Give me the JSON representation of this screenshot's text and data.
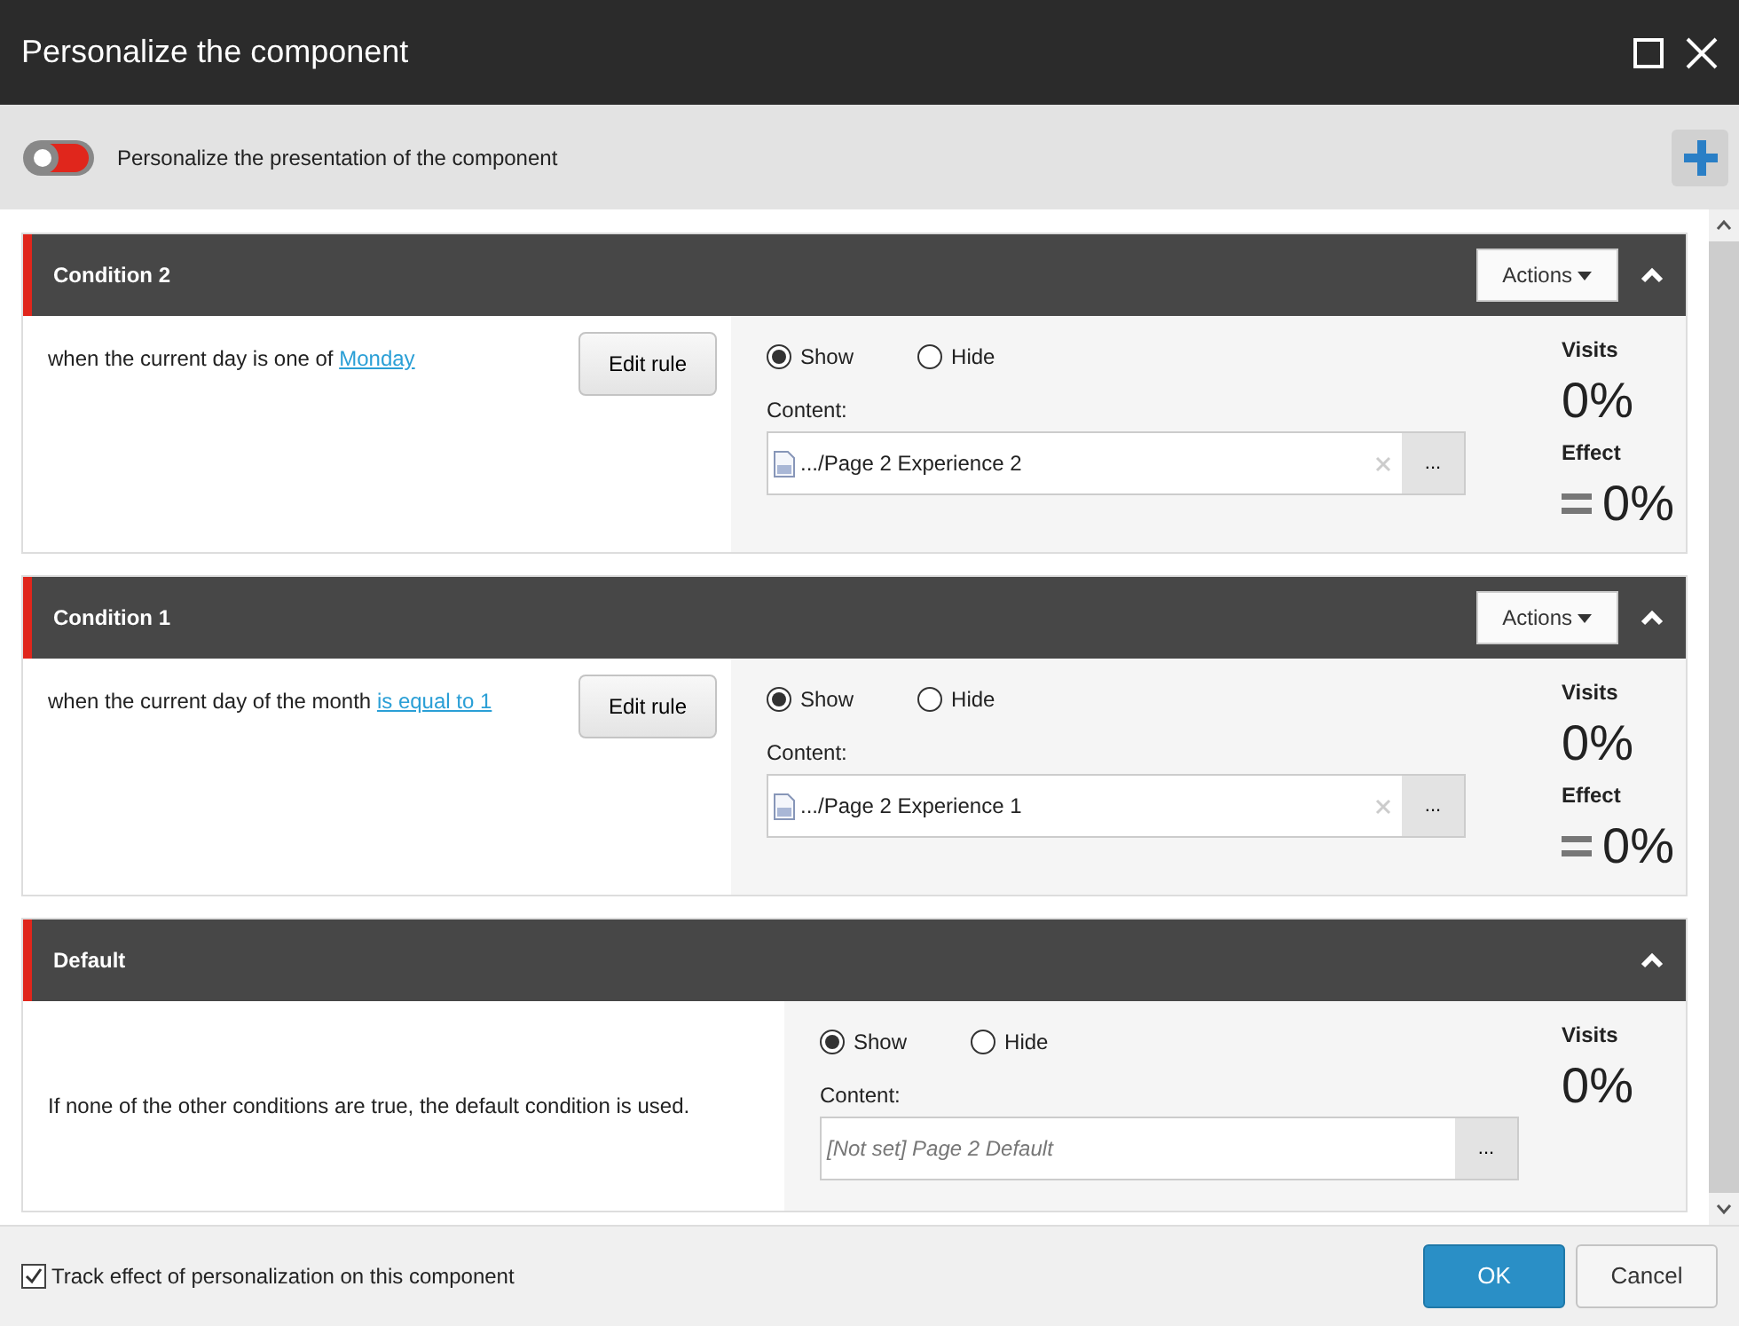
{
  "window": {
    "title": "Personalize the component"
  },
  "toolbar": {
    "toggle_on": false,
    "label": "Personalize the presentation of the component"
  },
  "panels": [
    {
      "kind": "condition",
      "title": "Condition 2",
      "expanded": true,
      "actions": "Actions",
      "rule": {
        "text": "when the current day is one of ",
        "link": "Monday"
      },
      "edit_button": "Edit rule",
      "options": [
        {
          "label": "Show",
          "selected": true
        },
        {
          "label": "Hide",
          "selected": false
        }
      ],
      "content_label": "Content:",
      "content": {
        "value": ".../Page 2 Experience 2",
        "is_set": true,
        "browse": "..."
      },
      "visits_label": "Visits",
      "visits": "0%",
      "effect_label": "Effect",
      "effect": "0%"
    },
    {
      "kind": "condition",
      "title": "Condition 1",
      "expanded": true,
      "actions": "Actions",
      "rule": {
        "text": "when the current day of the month ",
        "link": "is equal to 1"
      },
      "edit_button": "Edit rule",
      "options": [
        {
          "label": "Show",
          "selected": true
        },
        {
          "label": "Hide",
          "selected": false
        }
      ],
      "content_label": "Content:",
      "content": {
        "value": ".../Page 2 Experience 1",
        "is_set": true,
        "browse": "..."
      },
      "visits_label": "Visits",
      "visits": "0%",
      "effect_label": "Effect",
      "effect": "0%"
    },
    {
      "kind": "default",
      "title": "Default",
      "expanded": true,
      "description": "If none of the other conditions are true, the default condition is used.",
      "options": [
        {
          "label": "Show",
          "selected": true
        },
        {
          "label": "Hide",
          "selected": false
        }
      ],
      "content_label": "Content:",
      "content": {
        "value": "[Not set] Page 2 Default",
        "is_set": false,
        "browse": "..."
      },
      "visits_label": "Visits",
      "visits": "0%"
    }
  ],
  "footer": {
    "track_label": "Track effect of personalization on this component",
    "track_checked": true,
    "buttons": [
      {
        "label": "OK",
        "kind": "primary"
      },
      {
        "label": "Cancel",
        "kind": "secondary"
      }
    ]
  }
}
